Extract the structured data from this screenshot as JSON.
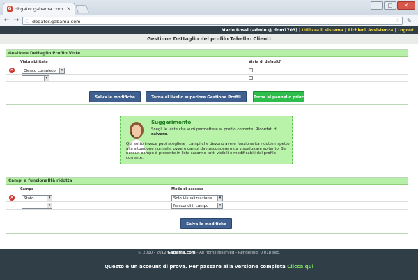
{
  "browser": {
    "tab_title": "dbgator.gabama.com",
    "tab_close": "×",
    "url": "dbgator.gabama.com",
    "win_min": "–",
    "win_max": "□",
    "win_close": "✕"
  },
  "header": {
    "user": "Mario Rossi (admin @ dom1703)",
    "separator": "|",
    "link_system": "Utilizza il sistema",
    "link_help": "Richiedi Assistenza",
    "link_logout": "Logout"
  },
  "page_title": "Gestione Dettaglio del profilo Tabella: Clienti",
  "views_section": {
    "title": "Gestione Dettaglio Profilo Viste",
    "col_view": "Vista abilitata",
    "col_default": "Vista di default?",
    "rows": [
      {
        "value": "Elenco completo"
      },
      {
        "value": ""
      }
    ],
    "btn_save": "Salva le modifiche",
    "btn_up": "Torna al livello superiore Gestione Profili",
    "btn_main": "Torna al pannello principale"
  },
  "suggestion": {
    "title": "Suggerimento",
    "line1": "Scegli le viste che vuoi permettere al profilo corrente. Ricordati di",
    "line1_bold": "salvare",
    "body": "Qui sotto invece puoi scegliere i campi che devono avere funzionalità ridotte rispetto alla situazione normale, ovvero campi da nascondere o da visualizzare soltanto. Se nessun campo è presente in lista saranno tutti visibili e modificabili dal profilo corrente."
  },
  "fields_section": {
    "title": "Campi a funzionalità ridotta",
    "col_field": "Campo",
    "col_mode": "Modo di accesso",
    "rows": [
      {
        "field": "Stato",
        "mode": "Solo Visualizzazione"
      },
      {
        "field": "",
        "mode": "Nascondi il campo"
      }
    ],
    "btn_save": "Salva le modifiche"
  },
  "footer": {
    "copyright_pre": "© 2010 - 2012",
    "brand": "Gabama.com",
    "copyright_post": "- All rights reserved - Rendering: 0.018 sec.",
    "trial_text": "Questo è un account di prova. Per passare alla versione completa",
    "trial_link": "Clicca qui"
  },
  "colors": {
    "header_bg": "#2f3e47",
    "section_head": "#b6f0a8",
    "button_blue": "#40618f",
    "button_green": "#2dbd4b",
    "accent_yellow": "#f0d23c"
  }
}
